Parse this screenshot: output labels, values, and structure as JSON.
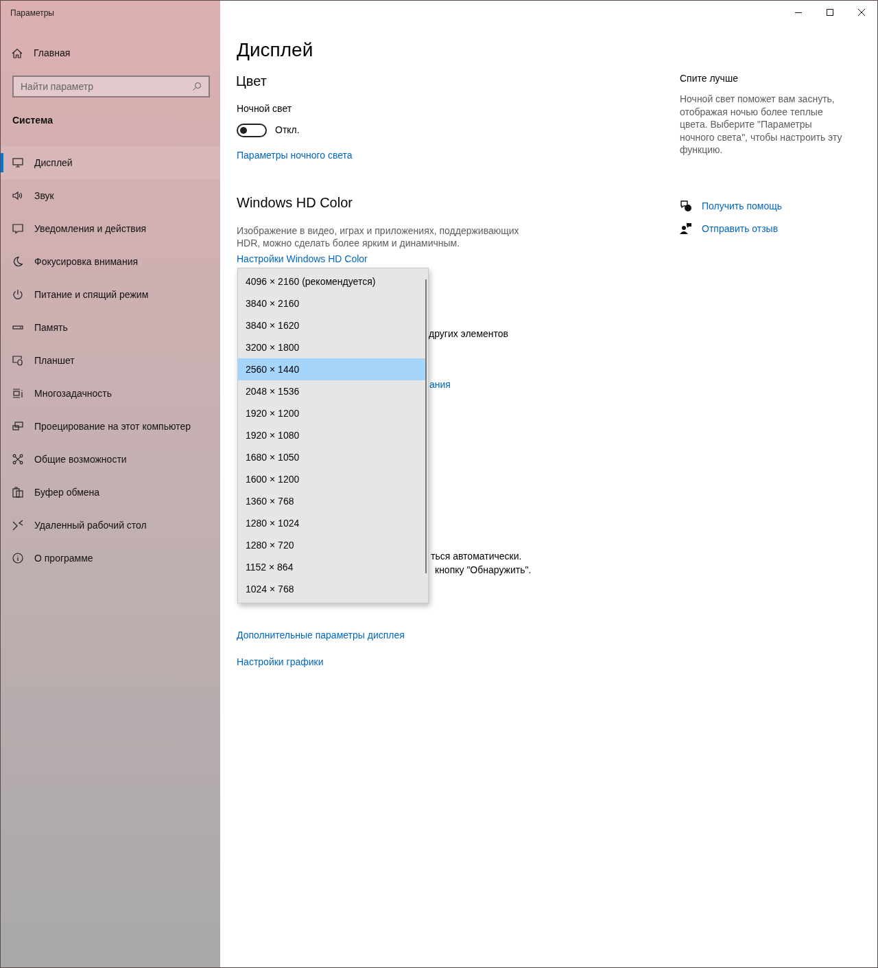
{
  "window": {
    "title": "Параметры"
  },
  "sidebar": {
    "home": "Главная",
    "search": {
      "placeholder": "Найти параметр"
    },
    "section": "Система",
    "items": [
      {
        "label": "Дисплей",
        "selected": true
      },
      {
        "label": "Звук",
        "selected": false
      },
      {
        "label": "Уведомления и действия",
        "selected": false
      },
      {
        "label": "Фокусировка внимания",
        "selected": false
      },
      {
        "label": "Питание и спящий режим",
        "selected": false
      },
      {
        "label": "Память",
        "selected": false
      },
      {
        "label": "Планшет",
        "selected": false
      },
      {
        "label": "Многозадачность",
        "selected": false
      },
      {
        "label": "Проецирование на этот компьютер",
        "selected": false
      },
      {
        "label": "Общие возможности",
        "selected": false
      },
      {
        "label": "Буфер обмена",
        "selected": false
      },
      {
        "label": "Удаленный рабочий стол",
        "selected": false
      },
      {
        "label": "О программе",
        "selected": false
      }
    ]
  },
  "main": {
    "title": "Дисплей",
    "color": {
      "heading": "Цвет",
      "night_light": {
        "label": "Ночной свет",
        "on": false,
        "state_text": "Откл."
      },
      "link": "Параметры ночного света"
    },
    "hdr": {
      "heading": "Windows HD Color",
      "description": "Изображение в видео, играх и приложениях, поддерживающих HDR, можно сделать более ярким и динамичным.",
      "link": "Настройки Windows HD Color"
    },
    "resolution_dropdown": {
      "options": [
        {
          "label": "4096 × 2160 (рекомендуется)",
          "selected": false
        },
        {
          "label": "3840 × 2160",
          "selected": false
        },
        {
          "label": "3840 × 1620",
          "selected": false
        },
        {
          "label": "3200 × 1800",
          "selected": false
        },
        {
          "label": "2560 × 1440",
          "selected": true
        },
        {
          "label": "2048 × 1536",
          "selected": false
        },
        {
          "label": "1920 × 1200",
          "selected": false
        },
        {
          "label": "1920 × 1080",
          "selected": false
        },
        {
          "label": "1680 × 1050",
          "selected": false
        },
        {
          "label": "1600 × 1200",
          "selected": false
        },
        {
          "label": "1360 × 768",
          "selected": false
        },
        {
          "label": "1280 × 1024",
          "selected": false
        },
        {
          "label": "1280 × 720",
          "selected": false
        },
        {
          "label": "1152 × 864",
          "selected": false
        },
        {
          "label": "1024 × 768",
          "selected": false
        }
      ]
    },
    "covered_fragments": [
      {
        "text": "других элементов",
        "kind": "text"
      },
      {
        "text": "ания",
        "kind": "link"
      },
      {
        "text": "ться автоматически.",
        "kind": "text"
      },
      {
        "text": "кнопку \"Обнаружить\".",
        "kind": "text"
      }
    ],
    "links": [
      "Дополнительные параметры дисплея",
      "Настройки графики"
    ]
  },
  "aside": {
    "heading": "Спите лучше",
    "text": "Ночной свет поможет вам заснуть, отображая ночью более теплые цвета. Выберите \"Параметры ночного света\", чтобы настроить эту функцию.",
    "links": [
      "Получить помощь",
      "Отправить отзыв"
    ]
  }
}
